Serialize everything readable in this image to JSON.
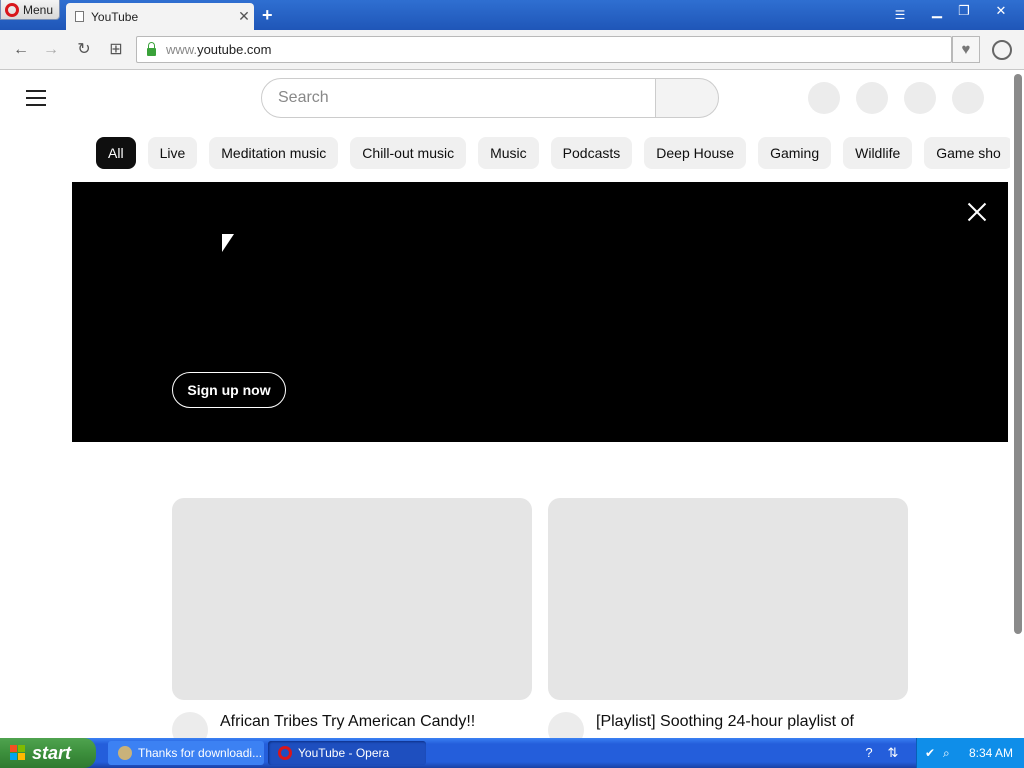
{
  "browser": {
    "menu_label": "Menu",
    "tab_title": "YouTube",
    "tab_close": "✕",
    "new_tab": "+",
    "address_prefix": "www.",
    "address_host": "youtube.com"
  },
  "youtube": {
    "search_placeholder": "Search",
    "chips": [
      "All",
      "Live",
      "Meditation music",
      "Chill-out music",
      "Music",
      "Podcasts",
      "Deep House",
      "Gaming",
      "Wildlife",
      "Game sho"
    ],
    "banner": {
      "signup_label": "Sign up now"
    },
    "videos": [
      {
        "title": "African Tribes Try American Candy!!"
      },
      {
        "title": "[Playlist] Soothing 24-hour playlist of"
      }
    ]
  },
  "taskbar": {
    "start_label": "start",
    "items": [
      {
        "label": "Thanks for downloadi..."
      },
      {
        "label": "YouTube - Opera"
      }
    ],
    "clock": "8:34 AM"
  },
  "colors": {
    "opera_red": "#d8161b",
    "youtube_chip_active": "#0f0f0f",
    "xp_taskbar": "#245edb",
    "xp_start": "#3c8f3c"
  }
}
